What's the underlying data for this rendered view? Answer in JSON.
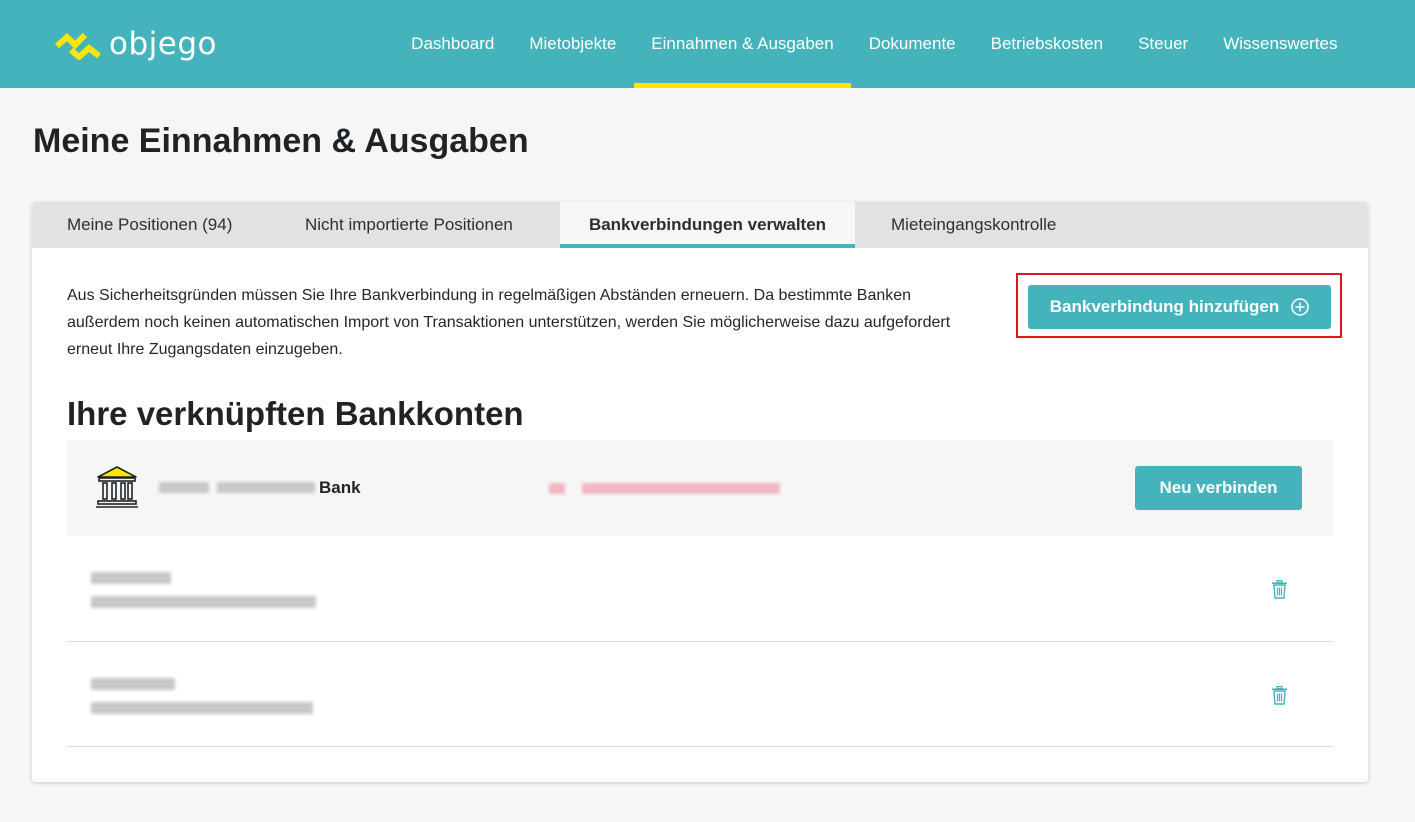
{
  "brand": {
    "name": "objego",
    "logo_color": "#ffe600"
  },
  "nav": {
    "items": [
      {
        "label": "Dashboard"
      },
      {
        "label": "Mietobjekte"
      },
      {
        "label": "Einnahmen & Ausgaben"
      },
      {
        "label": "Dokumente"
      },
      {
        "label": "Betriebskosten"
      },
      {
        "label": "Steuer"
      },
      {
        "label": "Wissenswertes"
      }
    ],
    "active": "Einnahmen & Ausgaben"
  },
  "page": {
    "title": "Meine Einnahmen & Ausgaben"
  },
  "tabs": {
    "items": [
      {
        "label": "Meine Positionen (94)"
      },
      {
        "label": "Nicht importierte Positionen"
      },
      {
        "label": "Bankverbindungen verwalten"
      },
      {
        "label": "Mieteingangskontrolle"
      }
    ],
    "active": "Bankverbindungen verwalten"
  },
  "info": {
    "text": "Aus Sicherheitsgründen müssen Sie Ihre Bankverbindung in regelmäßigen Abständen erneuern. Da bestimmte Banken außerdem noch keinen automatischen Import von Transaktionen unterstützen, werden Sie möglicherweise dazu aufgefordert erneut Ihre Zugangsdaten einzugeben."
  },
  "add_button": {
    "label": "Bankverbindung hinzufügen",
    "icon": "plus-circle-icon"
  },
  "accounts_section": {
    "title": "Ihre verknüpften Bankkonten",
    "bank": {
      "name_suffix": "Bank",
      "icon": "bank-icon",
      "reconnect_label": "Neu verbinden"
    },
    "accounts": [
      {
        "icon": "trash-icon"
      },
      {
        "icon": "trash-icon"
      }
    ]
  },
  "colors": {
    "primary": "#45b3bb",
    "accent": "#ffe600",
    "highlight": "#e3141b",
    "status_red": "#f1b7c3"
  }
}
